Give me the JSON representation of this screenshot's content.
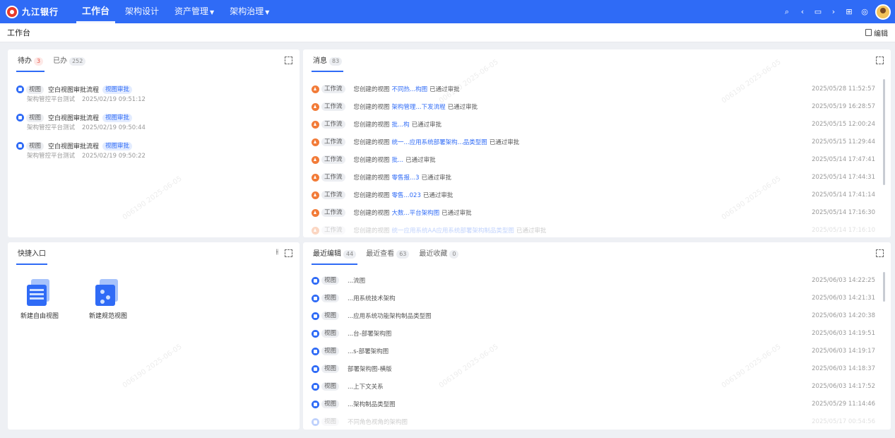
{
  "brand": {
    "logo_text": "九江银行"
  },
  "nav": {
    "items": [
      {
        "label": "工作台",
        "active": true,
        "dropdown": false
      },
      {
        "label": "架构设计",
        "active": false,
        "dropdown": false
      },
      {
        "label": "资产管理",
        "active": false,
        "dropdown": true
      },
      {
        "label": "架构治理",
        "active": false,
        "dropdown": true
      }
    ]
  },
  "subheader": {
    "title": "工作台",
    "edit_label": "编辑"
  },
  "todo_panel": {
    "tabs": [
      {
        "label": "待办",
        "count": "3",
        "active": true
      },
      {
        "label": "已办",
        "count": "252",
        "active": false
      }
    ],
    "items": [
      {
        "type": "视图",
        "title": "空白视图审批流程",
        "tag": "视图审批",
        "source": "架构管控平台测试",
        "time": "2025/02/19 09:51:12"
      },
      {
        "type": "视图",
        "title": "空白视图审批流程",
        "tag": "视图审批",
        "source": "架构管控平台测试",
        "time": "2025/02/19 09:50:44"
      },
      {
        "type": "视图",
        "title": "空白视图审批流程",
        "tag": "视图审批",
        "source": "架构管控平台测试",
        "time": "2025/02/19 09:50:22"
      }
    ]
  },
  "message_panel": {
    "tabs": [
      {
        "label": "消息",
        "count": "83",
        "active": true
      }
    ],
    "items": [
      {
        "type": "工作流",
        "prefix": "您创建的视图",
        "link": "不同热...构图",
        "status": "已通过审批",
        "time": "2025/05/28 11:52:57"
      },
      {
        "type": "工作流",
        "prefix": "您创建的视图",
        "link": "架构管理...下发流程",
        "status": "已通过审批",
        "time": "2025/05/19 16:28:57"
      },
      {
        "type": "工作流",
        "prefix": "您创建的视图",
        "link": "批...构",
        "status": "已通过审批",
        "time": "2025/05/15 12:00:24"
      },
      {
        "type": "工作流",
        "prefix": "您创建的视图",
        "link": "统一...应用系统部署架构...品类型图",
        "status": "已通过审批",
        "time": "2025/05/15 11:29:44"
      },
      {
        "type": "工作流",
        "prefix": "您创建的视图",
        "link": "批...",
        "status": "已通过审批",
        "time": "2025/05/14 17:47:41"
      },
      {
        "type": "工作流",
        "prefix": "您创建的视图",
        "link": "零售报...3",
        "status": "已通过审批",
        "time": "2025/05/14 17:44:31"
      },
      {
        "type": "工作流",
        "prefix": "您创建的视图",
        "link": "零售...023",
        "status": "已通过审批",
        "time": "2025/05/14 17:41:14"
      },
      {
        "type": "工作流",
        "prefix": "您创建的视图",
        "link": "大数...平台架构图",
        "status": "已通过审批",
        "time": "2025/05/14 17:16:30"
      },
      {
        "type": "工作流",
        "prefix": "您创建的视图",
        "link": "统一应用系统AA应用系统部署架构制品类型图",
        "status": "已通过审批",
        "time": "2025/05/14 17:16:10"
      }
    ]
  },
  "quick_panel": {
    "tabs": [
      {
        "label": "快捷入口",
        "active": true
      }
    ],
    "items": [
      {
        "label": "新建自由视图",
        "icon": "free-view-icon"
      },
      {
        "label": "新建规范视图",
        "icon": "standard-view-icon"
      }
    ]
  },
  "recent_panel": {
    "tabs": [
      {
        "label": "最近编辑",
        "count": "44",
        "active": true
      },
      {
        "label": "最近查看",
        "count": "63",
        "active": false
      },
      {
        "label": "最近收藏",
        "count": "0",
        "active": false
      }
    ],
    "items": [
      {
        "type": "视图",
        "title": "...流图",
        "time": "2025/06/03 14:22:25"
      },
      {
        "type": "视图",
        "title": "...用系统技术架构",
        "time": "2025/06/03 14:21:31"
      },
      {
        "type": "视图",
        "title": "...应用系统功能架构制品类型图",
        "time": "2025/06/03 14:20:38"
      },
      {
        "type": "视图",
        "title": "...台-部署架构图",
        "time": "2025/06/03 14:19:51"
      },
      {
        "type": "视图",
        "title": "...s-部署架构图",
        "time": "2025/06/03 14:19:17"
      },
      {
        "type": "视图",
        "title": "部署架构图-横版",
        "time": "2025/06/03 14:18:37"
      },
      {
        "type": "视图",
        "title": "...上下文关系",
        "time": "2025/06/03 14:17:52"
      },
      {
        "type": "视图",
        "title": "...架构制品类型图",
        "time": "2025/05/29 11:14:46"
      },
      {
        "type": "视图",
        "title": "不同角色视角的架构图",
        "time": "2025/05/17 00:54:56"
      }
    ]
  },
  "watermark": {
    "text": "006190 2025-06-05"
  },
  "colors": {
    "primary": "#2f6bf6",
    "workflow": "#f27b38",
    "badge_red": "#e8584a"
  }
}
